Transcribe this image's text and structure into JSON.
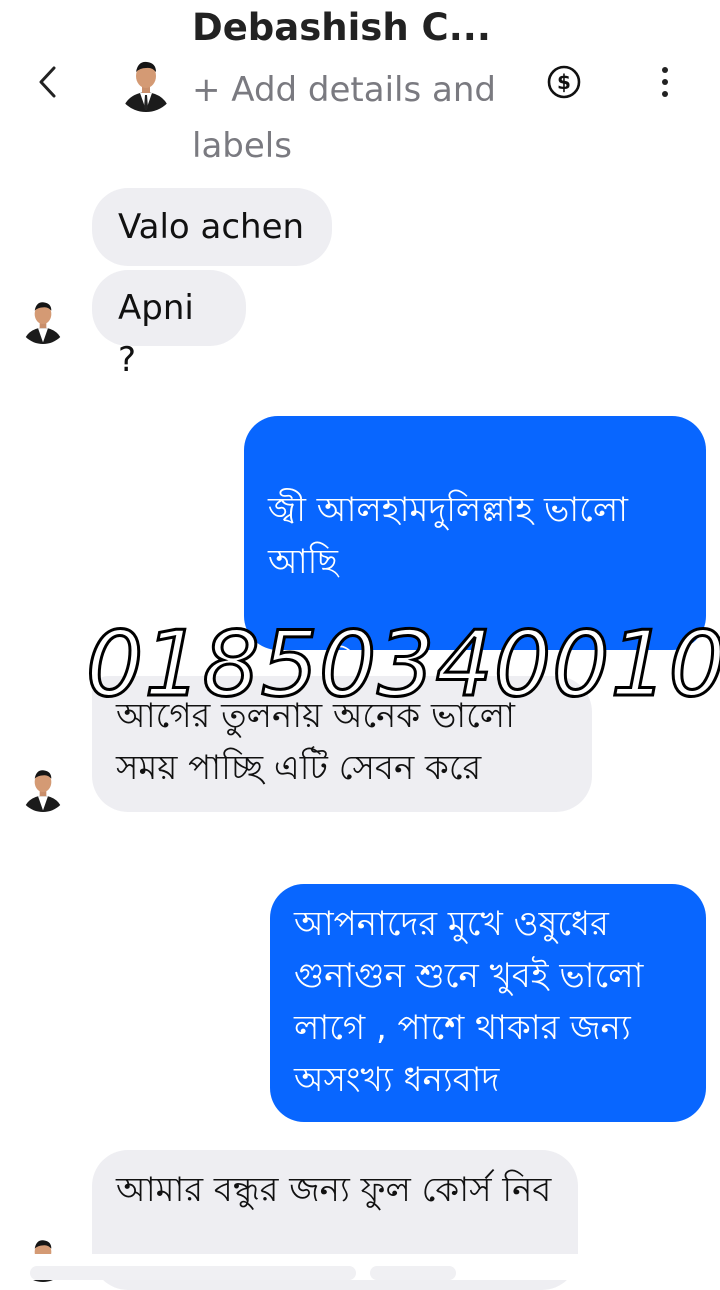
{
  "header": {
    "title": "Debashish C...",
    "subtitle": "+ Add details and labels",
    "icons": {
      "back": "chevron-left-icon",
      "payment": "dollar-circle-icon",
      "more": "more-vertical-icon"
    }
  },
  "messages": [
    {
      "side": "in",
      "text": "Valo achen"
    },
    {
      "side": "in",
      "text": "Apni ?"
    },
    {
      "side": "out",
      "text": "জ্বী আলহামদুলিল্লাহ ভালো আছি\n\nআপনি কেমন আছেন ?"
    },
    {
      "side": "in",
      "text": "আগের তুলনায় অনেক ভালো সময় পাচ্ছি এটি সেবন করে"
    },
    {
      "side": "out",
      "text": "আপনাদের মুখে ওষুধের গুনাগুন শুনে খুবই ভালো লাগে , পাশে থাকার জন্য অসংখ্য ধন্যবাদ"
    },
    {
      "side": "in",
      "text": "আমার বন্ধুর জন্য ফুল কোর্স নিব"
    }
  ],
  "watermark": "01850340010",
  "colors": {
    "outgoing_bubble": "#0866ff",
    "incoming_bubble": "#eeeef2"
  }
}
